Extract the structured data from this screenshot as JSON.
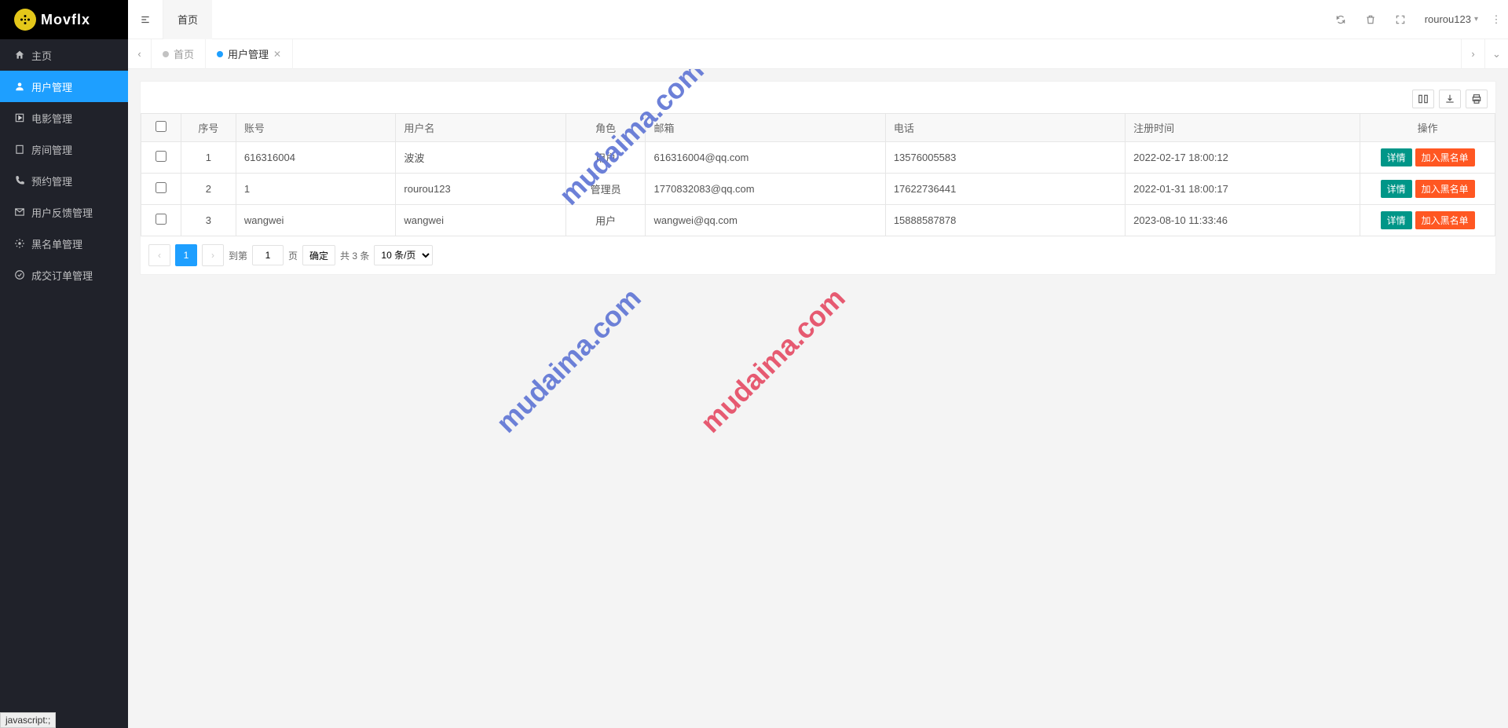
{
  "brand": {
    "name": "Movflx"
  },
  "sidebar": {
    "items": [
      {
        "label": "主页",
        "icon": "home"
      },
      {
        "label": "用户管理",
        "icon": "user"
      },
      {
        "label": "电影管理",
        "icon": "movie"
      },
      {
        "label": "房间管理",
        "icon": "room"
      },
      {
        "label": "预约管理",
        "icon": "phone"
      },
      {
        "label": "用户反馈管理",
        "icon": "mail"
      },
      {
        "label": "黑名单管理",
        "icon": "gear"
      },
      {
        "label": "成交订单管理",
        "icon": "check"
      }
    ]
  },
  "header": {
    "tab": "首页",
    "user": "rourou123"
  },
  "tabs": {
    "home": "首页",
    "active": "用户管理"
  },
  "table": {
    "columns": {
      "seq": "序号",
      "account": "账号",
      "username": "用户名",
      "role": "角色",
      "email": "邮箱",
      "phone": "电话",
      "regtime": "注册时间",
      "op": "操作"
    },
    "rows": [
      {
        "seq": "1",
        "account": "616316004",
        "username": "波波",
        "role": "用户",
        "email": "616316004@qq.com",
        "phone": "13576005583",
        "regtime": "2022-02-17 18:00:12"
      },
      {
        "seq": "2",
        "account": "1",
        "username": "rourou123",
        "role": "管理员",
        "email": "1770832083@qq.com",
        "phone": "17622736441",
        "regtime": "2022-01-31 18:00:17"
      },
      {
        "seq": "3",
        "account": "wangwei",
        "username": "wangwei",
        "role": "用户",
        "email": "wangwei@qq.com",
        "phone": "15888587878",
        "regtime": "2023-08-10 11:33:46"
      }
    ],
    "actions": {
      "detail": "详情",
      "blacklist": "加入黑名单"
    }
  },
  "pagination": {
    "current": "1",
    "goto_label_prefix": "到第",
    "goto_input": "1",
    "goto_label_suffix": "页",
    "confirm": "确定",
    "total": "共 3 条",
    "pagesize": "10 条/页"
  },
  "statusbar": "javascript:;",
  "watermark": "mudaima.com"
}
